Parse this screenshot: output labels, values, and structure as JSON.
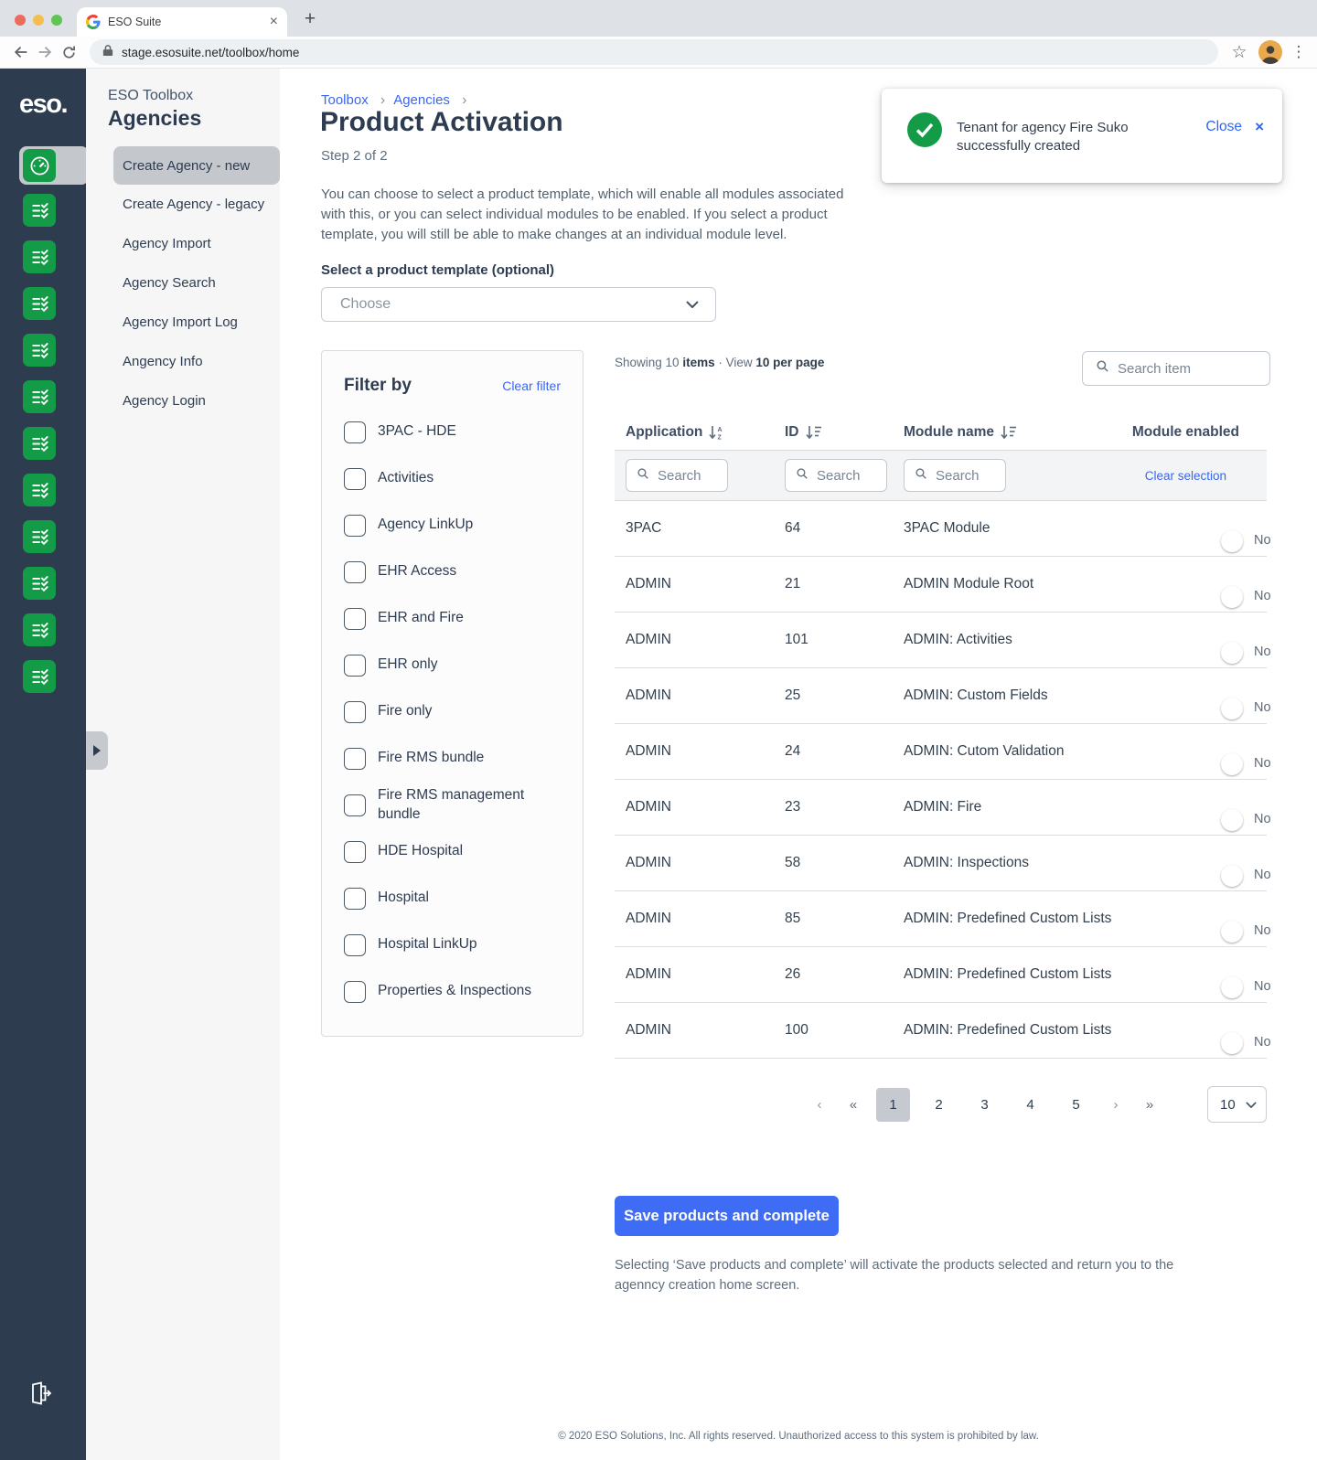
{
  "browser": {
    "tab_title": "ESO Suite",
    "url": "stage.esosuite.net/toolbox/home"
  },
  "rail": {
    "logo": "eso.",
    "checklist_icon_count": 11
  },
  "sidebar": {
    "app_title": "ESO Toolbox",
    "section_title": "Agencies",
    "items": [
      {
        "label": "Create Agency - new",
        "active": true
      },
      {
        "label": "Create Agency - legacy"
      },
      {
        "label": "Agency Import"
      },
      {
        "label": "Agency Search"
      },
      {
        "label": "Agency Import Log"
      },
      {
        "label": "Angency Info"
      },
      {
        "label": "Agency Login"
      }
    ]
  },
  "toast": {
    "message": "Tenant for agency Fire Suko successfully created",
    "close_label": "Close"
  },
  "page": {
    "breadcrumb": [
      {
        "label": "Toolbox"
      },
      {
        "label": "Agencies"
      }
    ],
    "title": "Product Activation",
    "step": "Step 2 of 2",
    "description": "You can choose to select a product template, which will enable all modules associated with this, or you can select individual modules to be enabled. If you select a product template, you will still be able to make changes at an individual module level.",
    "template_label": "Select a product template (optional)",
    "template_placeholder": "Choose"
  },
  "filter": {
    "title": "Filter by",
    "clear_label": "Clear filter",
    "options": [
      "3PAC - HDE",
      "Activities",
      "Agency LinkUp",
      "EHR Access",
      "EHR and Fire",
      "EHR only",
      "Fire only",
      "Fire RMS bundle",
      "Fire RMS management bundle",
      "HDE Hospital",
      "Hospital",
      "Hospital LinkUp",
      "Properties & Inspections"
    ]
  },
  "table": {
    "summary": {
      "showing": "Showing 10",
      "items": "items",
      "view": "· View",
      "per_page": "10 per page"
    },
    "search_placeholder": "Search item",
    "column_search_placeholder": "Search",
    "clear_selection_label": "Clear selection",
    "columns": [
      {
        "label": "Application"
      },
      {
        "label": "ID"
      },
      {
        "label": "Module name"
      },
      {
        "label": "Module enabled"
      }
    ],
    "rows": [
      {
        "application": "3PAC",
        "id": "64",
        "module": "3PAC Module",
        "enabled": "No"
      },
      {
        "application": "ADMIN",
        "id": "21",
        "module": "ADMIN Module Root",
        "enabled": "No"
      },
      {
        "application": "ADMIN",
        "id": "101",
        "module": "ADMIN: Activities",
        "enabled": "No"
      },
      {
        "application": "ADMIN",
        "id": "25",
        "module": "ADMIN: Custom Fields",
        "enabled": "No"
      },
      {
        "application": "ADMIN",
        "id": "24",
        "module": "ADMIN: Cutom Validation",
        "enabled": "No"
      },
      {
        "application": "ADMIN",
        "id": "23",
        "module": "ADMIN: Fire",
        "enabled": "No"
      },
      {
        "application": "ADMIN",
        "id": "58",
        "module": "ADMIN: Inspections",
        "enabled": "No"
      },
      {
        "application": "ADMIN",
        "id": "85",
        "module": "ADMIN: Predefined Custom Lists",
        "enabled": "No"
      },
      {
        "application": "ADMIN",
        "id": "26",
        "module": "ADMIN: Predefined Custom Lists",
        "enabled": "No"
      },
      {
        "application": "ADMIN",
        "id": "100",
        "module": "ADMIN: Predefined Custom Lists",
        "enabled": "No"
      }
    ],
    "pagination": {
      "prev": "‹",
      "first": "«",
      "next": "›",
      "last": "»",
      "pages": [
        {
          "label": "1",
          "current": true
        },
        {
          "label": "2"
        },
        {
          "label": "3"
        },
        {
          "label": "4"
        },
        {
          "label": "5"
        }
      ],
      "page_size": "10"
    }
  },
  "actions": {
    "save_label": "Save products and complete",
    "save_note": "Selecting ‘Save products and complete’ will activate the products selected and return you to the agenncy creation home screen."
  },
  "footer": {
    "copyright": "© 2020 ESO Solutions, Inc. All rights reserved. Unauthorized access to this system is prohibited by law."
  },
  "colors": {
    "accent_blue": "#3a66f2",
    "success_green": "#149b47",
    "rail_navy": "#2d3c4f",
    "toggle_gray": "#b9bec4"
  }
}
